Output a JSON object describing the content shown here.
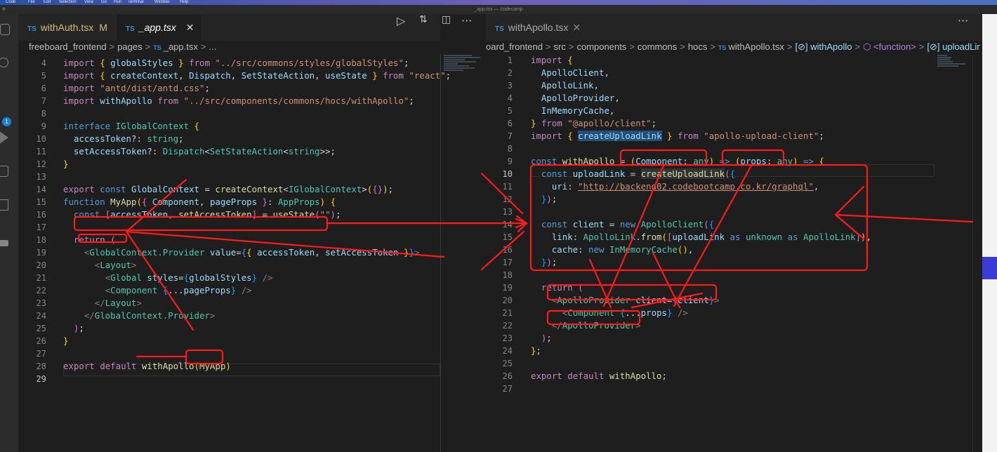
{
  "window": {
    "title": "_app.tsx — codecamp",
    "menu": [
      "Code",
      "File",
      "Edit",
      "Selection",
      "View",
      "Go",
      "Run",
      "Terminal",
      "Window",
      "Help"
    ]
  },
  "activity_bar": {
    "icons": [
      "explorer-icon",
      "search-icon",
      "source-control-icon",
      "run-debug-icon",
      "remote-explorer-icon",
      "extensions-icon",
      "docker-icon"
    ],
    "source_control_badge": "1"
  },
  "left_editor": {
    "tabs": [
      {
        "prefix": "TS",
        "label": "withAuth.tsx",
        "modified": "M"
      },
      {
        "prefix": "TS",
        "label": "_app.tsx",
        "close": "✕"
      }
    ],
    "breadcrumb": [
      "freeboard_frontend",
      "pages",
      "TS",
      "_app.tsx",
      "..."
    ],
    "line_numbers": [
      "4",
      "5",
      "6",
      "7",
      "8",
      "9",
      "10",
      "11",
      "12",
      "13",
      "14",
      "15",
      "16",
      "17",
      "18",
      "19",
      "20",
      "21",
      "22",
      "23",
      "24",
      "25",
      "26",
      "27",
      "28",
      "29"
    ]
  },
  "right_editor": {
    "tabs": [
      {
        "prefix": "TS",
        "label": "withApollo.tsx",
        "close": "✕"
      }
    ],
    "more": "···",
    "breadcrumb": [
      "oard_frontend",
      "src",
      "components",
      "commons",
      "hocs",
      "TS",
      "withApollo.tsx",
      "[⊘] withApollo",
      "⬡ <function>",
      "[⊘] uploadLink"
    ],
    "line_numbers": [
      "1",
      "2",
      "3",
      "4",
      "5",
      "6",
      "7",
      "8",
      "9",
      "10",
      "11",
      "12",
      "13",
      "14",
      "15",
      "16",
      "17",
      "18",
      "19",
      "20",
      "21",
      "22",
      "23",
      "24",
      "25",
      "26",
      "27"
    ]
  },
  "colors": {
    "editor_bg": "#1e1e1e",
    "tab_bar": "#252526",
    "annotation": "#ff1a1a",
    "keyword": "#569cd6",
    "string": "#ce9178"
  }
}
